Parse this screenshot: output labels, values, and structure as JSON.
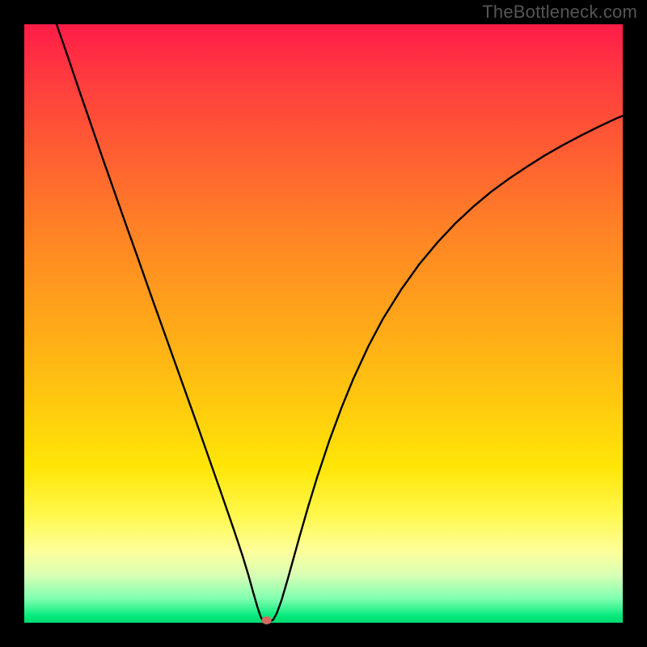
{
  "watermark": "TheBottleneck.com",
  "chart_data": {
    "type": "line",
    "title": "",
    "xlabel": "",
    "ylabel": "",
    "xlim": [
      0,
      100
    ],
    "ylim": [
      0,
      100
    ],
    "grid": false,
    "notch": {
      "x": 40.5,
      "y": 0
    },
    "series": [
      {
        "name": "curve",
        "color": "#000000",
        "points": [
          {
            "x": 5.4,
            "y": 100.0
          },
          {
            "x": 7.0,
            "y": 95.4
          },
          {
            "x": 9.0,
            "y": 89.5
          },
          {
            "x": 11.0,
            "y": 83.7
          },
          {
            "x": 13.0,
            "y": 77.9
          },
          {
            "x": 15.0,
            "y": 72.2
          },
          {
            "x": 17.0,
            "y": 66.5
          },
          {
            "x": 19.0,
            "y": 60.9
          },
          {
            "x": 21.0,
            "y": 55.2
          },
          {
            "x": 23.0,
            "y": 49.6
          },
          {
            "x": 25.0,
            "y": 44.0
          },
          {
            "x": 27.0,
            "y": 38.4
          },
          {
            "x": 29.0,
            "y": 32.8
          },
          {
            "x": 31.0,
            "y": 27.1
          },
          {
            "x": 33.0,
            "y": 21.4
          },
          {
            "x": 35.0,
            "y": 15.6
          },
          {
            "x": 36.5,
            "y": 11.1
          },
          {
            "x": 37.5,
            "y": 7.8
          },
          {
            "x": 38.3,
            "y": 4.9
          },
          {
            "x": 39.0,
            "y": 2.5
          },
          {
            "x": 39.5,
            "y": 1.0
          },
          {
            "x": 39.9,
            "y": 0.3
          },
          {
            "x": 40.2,
            "y": 0.2
          },
          {
            "x": 41.0,
            "y": 0.2
          },
          {
            "x": 41.6,
            "y": 0.5
          },
          {
            "x": 42.2,
            "y": 1.6
          },
          {
            "x": 43.0,
            "y": 3.8
          },
          {
            "x": 44.0,
            "y": 7.2
          },
          {
            "x": 45.0,
            "y": 10.8
          },
          {
            "x": 46.0,
            "y": 14.4
          },
          {
            "x": 47.5,
            "y": 19.6
          },
          {
            "x": 49.0,
            "y": 24.5
          },
          {
            "x": 51.0,
            "y": 30.5
          },
          {
            "x": 53.0,
            "y": 35.9
          },
          {
            "x": 55.0,
            "y": 40.8
          },
          {
            "x": 57.5,
            "y": 46.2
          },
          {
            "x": 60.0,
            "y": 50.9
          },
          {
            "x": 63.0,
            "y": 55.7
          },
          {
            "x": 66.0,
            "y": 59.9
          },
          {
            "x": 69.0,
            "y": 63.5
          },
          {
            "x": 72.0,
            "y": 66.7
          },
          {
            "x": 75.0,
            "y": 69.5
          },
          {
            "x": 78.0,
            "y": 72.0
          },
          {
            "x": 81.0,
            "y": 74.2
          },
          {
            "x": 84.0,
            "y": 76.2
          },
          {
            "x": 87.0,
            "y": 78.1
          },
          {
            "x": 90.0,
            "y": 79.8
          },
          {
            "x": 93.0,
            "y": 81.4
          },
          {
            "x": 96.0,
            "y": 82.9
          },
          {
            "x": 99.0,
            "y": 84.3
          },
          {
            "x": 100.0,
            "y": 84.7
          }
        ]
      }
    ],
    "marker": {
      "x": 40.5,
      "y": 0.4,
      "color": "#d46a60",
      "rx": 6,
      "ry": 5
    }
  }
}
